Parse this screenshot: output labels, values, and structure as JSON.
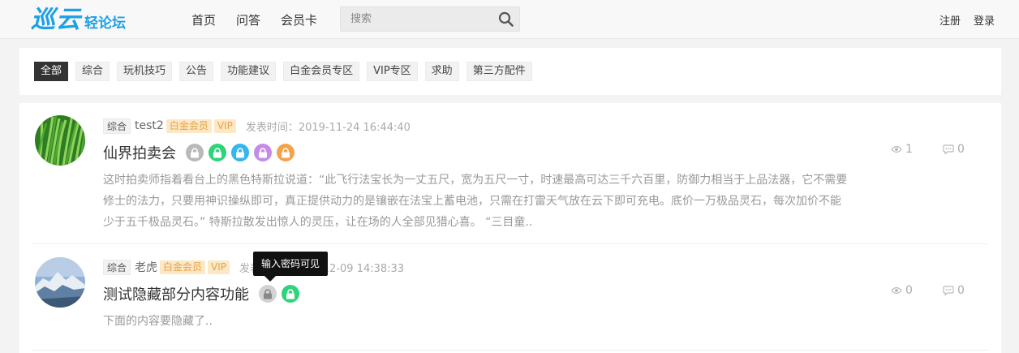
{
  "header": {
    "logo_main": "巡云",
    "logo_sub": "轻论坛",
    "nav": [
      "首页",
      "问答",
      "会员卡"
    ],
    "search_placeholder": "搜索",
    "auth": {
      "register": "注册",
      "login": "登录"
    }
  },
  "categories": {
    "items": [
      "全部",
      "综合",
      "玩机技巧",
      "公告",
      "功能建议",
      "白金会员专区",
      "VIP专区",
      "求助",
      "第三方配件"
    ],
    "active": "全部"
  },
  "posts": [
    {
      "category": "综合",
      "author": "test2",
      "badges": [
        "白金会员",
        "VIP"
      ],
      "time": "发表时间：2019-11-24 16:44:40",
      "title": "仙界拍卖会",
      "locks": [
        "#b9b9b9",
        "#2ed47a",
        "#37b5ef",
        "#c48ce8",
        "#f5a34a"
      ],
      "excerpt": "这时拍卖师指着看台上的黑色特斯拉说道：“此飞行法宝长为一丈五尺，宽为五尺一寸，时速最高可达三千六百里，防御力相当于上品法器，它不需要修士的法力，只要用神识操纵即可，真正提供动力的是镶嵌在法宝上蓄电池，只需在打雷天气放在云下即可充电。底价一万极品灵石，每次加价不能少于五千极品灵石。” 特斯拉散发出惊人的灵压，让在场的人全部见猎心喜。 “三目童..",
      "views": "1",
      "comments": "0"
    },
    {
      "category": "综合",
      "author": "老虎",
      "badges": [
        "白金会员",
        "VIP"
      ],
      "time": "发表时间：2019-12-09 14:38:33",
      "title": "测试隐藏部分内容功能",
      "locks": [
        "#b9b9b9",
        "#2ed47a"
      ],
      "excerpt": "下面的内容要隐藏了..",
      "views": "0",
      "comments": "0"
    }
  ],
  "tooltip": "输入密码可见",
  "colors": {
    "brand": "#1ea0e6",
    "badge_bg": "#fde8c6",
    "badge_text": "#e4a449",
    "active_category": "#333333"
  }
}
